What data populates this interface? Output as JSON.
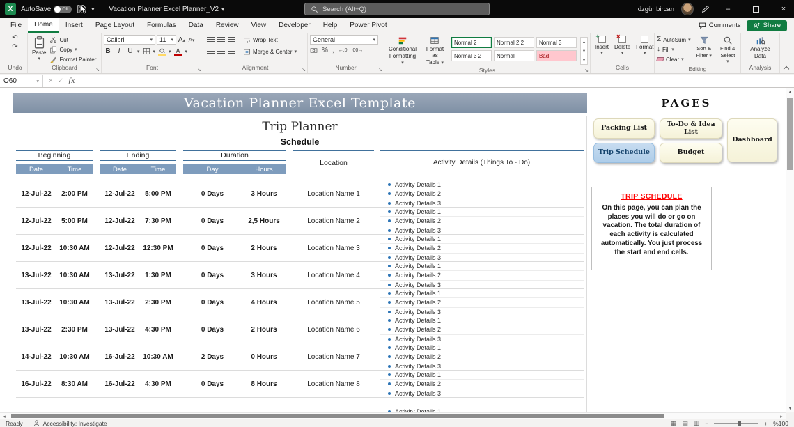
{
  "title_bar": {
    "autosave_label": "AutoSave",
    "autosave_state": "Off",
    "doc_title": "Vacation Planner Excel Planner_V2",
    "search_placeholder": "Search (Alt+Q)",
    "user_name": "özgür bircan"
  },
  "ribbon": {
    "tabs": [
      "File",
      "Home",
      "Insert",
      "Page Layout",
      "Formulas",
      "Data",
      "Review",
      "View",
      "Developer",
      "Help",
      "Power Pivot"
    ],
    "active_tab": "Home",
    "comments_label": "Comments",
    "share_label": "Share",
    "undo": {
      "label": "Undo"
    },
    "clipboard": {
      "label": "Clipboard",
      "paste": "Paste",
      "cut": "Cut",
      "copy": "Copy",
      "format_painter": "Format Painter"
    },
    "font": {
      "label": "Font",
      "name": "Calibri",
      "size": "11"
    },
    "alignment": {
      "label": "Alignment",
      "wrap_text": "Wrap Text",
      "merge_center": "Merge & Center"
    },
    "number": {
      "label": "Number",
      "format": "General"
    },
    "styles": {
      "label": "Styles",
      "conditional_line1": "Conditional",
      "conditional_line2": "Formatting",
      "format_table_line1": "Format as",
      "format_table_line2": "Table",
      "cell_styles": [
        "Normal 2",
        "Normal 2 2",
        "Normal 3",
        "Normal 3 2",
        "Normal",
        "Bad"
      ]
    },
    "cells": {
      "label": "Cells",
      "insert": "Insert",
      "delete": "Delete",
      "format": "Format"
    },
    "editing": {
      "label": "Editing",
      "autosum": "AutoSum",
      "fill": "Fill",
      "clear": "Clear",
      "sort_line1": "Sort &",
      "sort_line2": "Filter",
      "find_line1": "Find &",
      "find_line2": "Select"
    },
    "analysis": {
      "label": "Analysis",
      "analyze_line1": "Analyze",
      "analyze_line2": "Data"
    }
  },
  "formula_bar": {
    "cell_ref": "O60"
  },
  "sheet": {
    "banner_title": "Vacation Planner Excel Template",
    "pages_title": "PAGES",
    "title": "Trip Planner",
    "subtitle": "Schedule",
    "headers": {
      "beginning": "Beginning",
      "ending": "Ending",
      "duration": "Duration",
      "location": "Location",
      "activity": "Activity Details (Things To - Do)",
      "date": "Date",
      "time": "Time",
      "day": "Day",
      "hours": "Hours"
    },
    "rows": [
      {
        "begin_date": "12-Jul-22",
        "begin_time": "2:00 PM",
        "end_date": "12-Jul-22",
        "end_time": "5:00 PM",
        "days": "0 Days",
        "hours": "3 Hours",
        "location": "Location Name 1",
        "activities": [
          "Activity Details 1",
          "Activity Details 2",
          "Activity Details 3"
        ]
      },
      {
        "begin_date": "12-Jul-22",
        "begin_time": "5:00 PM",
        "end_date": "12-Jul-22",
        "end_time": "7:30 PM",
        "days": "0 Days",
        "hours": "2,5 Hours",
        "location": "Location Name 2",
        "activities": [
          "Activity Details 1",
          "Activity Details 2",
          "Activity Details 3"
        ]
      },
      {
        "begin_date": "12-Jul-22",
        "begin_time": "10:30 AM",
        "end_date": "12-Jul-22",
        "end_time": "12:30 PM",
        "days": "0 Days",
        "hours": "2 Hours",
        "location": "Location Name 3",
        "activities": [
          "Activity Details 1",
          "Activity Details 2",
          "Activity Details 3"
        ]
      },
      {
        "begin_date": "13-Jul-22",
        "begin_time": "10:30 AM",
        "end_date": "13-Jul-22",
        "end_time": "1:30 PM",
        "days": "0 Days",
        "hours": "3 Hours",
        "location": "Location Name 4",
        "activities": [
          "Activity Details 1",
          "Activity Details 2",
          "Activity Details 3"
        ]
      },
      {
        "begin_date": "13-Jul-22",
        "begin_time": "10:30 AM",
        "end_date": "13-Jul-22",
        "end_time": "2:30 PM",
        "days": "0 Days",
        "hours": "4 Hours",
        "location": "Location Name 5",
        "activities": [
          "Activity Details 1",
          "Activity Details 2",
          "Activity Details 3"
        ]
      },
      {
        "begin_date": "13-Jul-22",
        "begin_time": "2:30 PM",
        "end_date": "13-Jul-22",
        "end_time": "4:30 PM",
        "days": "0 Days",
        "hours": "2 Hours",
        "location": "Location Name 6",
        "activities": [
          "Activity Details 1",
          "Activity Details 2",
          "Activity Details 3"
        ]
      },
      {
        "begin_date": "14-Jul-22",
        "begin_time": "10:30 AM",
        "end_date": "16-Jul-22",
        "end_time": "10:30 AM",
        "days": "2 Days",
        "hours": "0 Hours",
        "location": "Location Name 7",
        "activities": [
          "Activity Details 1",
          "Activity Details 2",
          "Activity Details 3"
        ]
      },
      {
        "begin_date": "16-Jul-22",
        "begin_time": "8:30 AM",
        "end_date": "16-Jul-22",
        "end_time": "4:30 PM",
        "days": "0 Days",
        "hours": "8 Hours",
        "location": "Location Name 8",
        "activities": [
          "Activity Details 1",
          "Activity Details 2",
          "Activity Details 3"
        ]
      }
    ],
    "partial_row_activity": "Activity Details 1",
    "pages_buttons": {
      "packing": "Packing List",
      "todo": "To-Do & Idea List",
      "dashboard": "Dashboard",
      "trip_schedule": "Trip Schedule",
      "budget": "Budget"
    },
    "info_box": {
      "title": "TRIP SCHEDULE",
      "body": "On this page, you can plan the places you will do or go on vacation. The total duration of each activity is calculated automatically. You just process the start and end cells."
    }
  },
  "status_bar": {
    "ready": "Ready",
    "accessibility": "Accessibility: Investigate",
    "zoom": "%100"
  },
  "icons": {
    "undo": "↶",
    "redo": "↷",
    "chevron_down": "▾",
    "chevron_up": "▴",
    "bold": "B",
    "italic": "I",
    "underline": "U",
    "letter_a": "A",
    "sigma": "Σ",
    "percent": "%",
    "comma": ",",
    "inc_decimal": "←.0",
    "dec_decimal": ".00→",
    "close": "×",
    "minimize": "–",
    "launcher": "↘",
    "scroll_up": "▲",
    "scroll_down": "▼",
    "scroll_left": "◂",
    "scroll_right": "▸",
    "view_normal": "▦",
    "view_layout": "▤",
    "view_break": "▥",
    "zoom_minus": "−",
    "zoom_plus": "+",
    "fx": "fx",
    "check": "✓",
    "fill_down": "↓",
    "currency": "¤"
  },
  "colors": {
    "accent_green": "#107C41",
    "header_blue": "#7E9CBD",
    "steel_line": "#41719C",
    "banner_blue": "#8B9AAE",
    "button_cream": "#FDFBE7",
    "trip_blue": "#BDD7EE",
    "title_red": "#FF0000",
    "bullet_blue": "#2E75B6",
    "bad_style_bg": "#FFC7CE",
    "bad_style_text": "#9C0006"
  }
}
